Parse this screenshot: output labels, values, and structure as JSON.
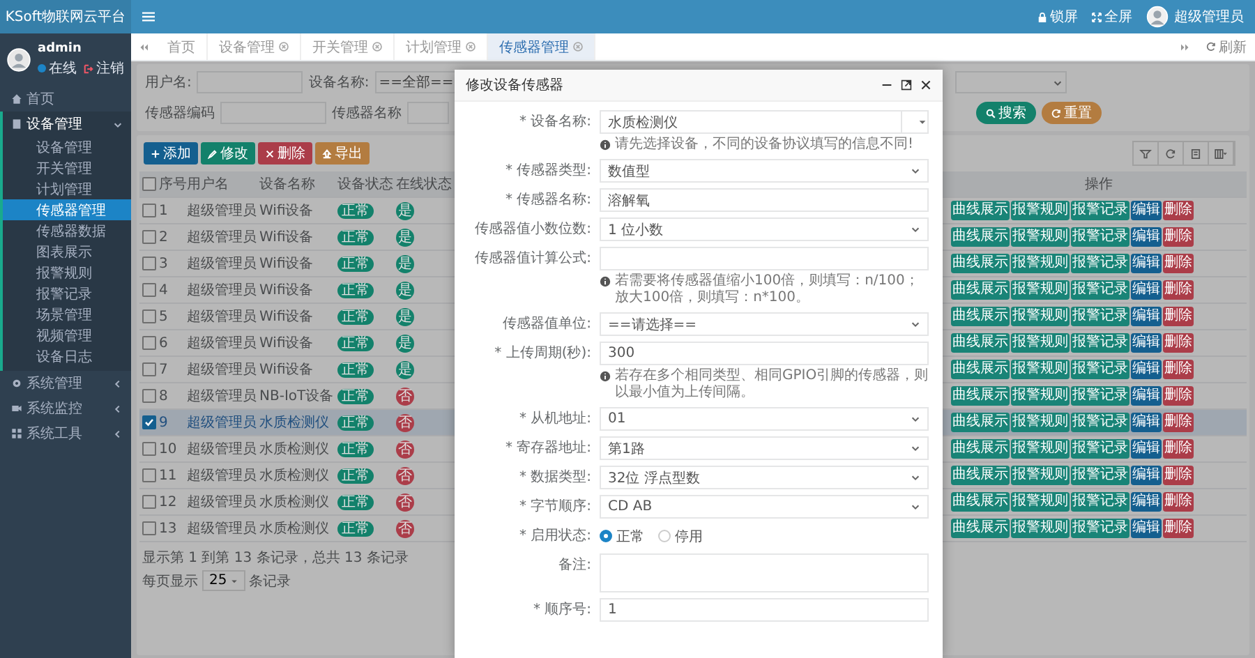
{
  "header": {
    "logo": "KSoft物联网云平台",
    "actions": [
      {
        "label": "锁屏"
      },
      {
        "label": "全屏"
      }
    ],
    "user": "超级管理员"
  },
  "sidebar": {
    "user": {
      "name": "admin",
      "status": "在线",
      "logout": "注销"
    },
    "menu": [
      {
        "kind": "link",
        "label": "首页"
      },
      {
        "kind": "group",
        "label": "设备管理",
        "expanded": true,
        "children": [
          {
            "label": "设备管理",
            "selected": false
          },
          {
            "label": "开关管理",
            "selected": false
          },
          {
            "label": "计划管理",
            "selected": false
          },
          {
            "label": "传感器管理",
            "selected": true
          },
          {
            "label": "传感器数据",
            "selected": false
          },
          {
            "label": "图表展示",
            "selected": false
          },
          {
            "label": "报警规则",
            "selected": false
          },
          {
            "label": "报警记录",
            "selected": false
          },
          {
            "label": "场景管理",
            "selected": false
          },
          {
            "label": "视频管理",
            "selected": false
          },
          {
            "label": "设备日志",
            "selected": false
          }
        ]
      },
      {
        "kind": "group",
        "label": "系统管理",
        "expanded": false
      },
      {
        "kind": "group",
        "label": "系统监控",
        "expanded": false
      },
      {
        "kind": "group",
        "label": "系统工具",
        "expanded": false
      }
    ]
  },
  "tabs": [
    {
      "label": "首页",
      "selected": false,
      "closable": false
    },
    {
      "label": "设备管理",
      "selected": false,
      "closable": true
    },
    {
      "label": "开关管理",
      "selected": false,
      "closable": true
    },
    {
      "label": "计划管理",
      "selected": false,
      "closable": true
    },
    {
      "label": "传感器管理",
      "selected": true,
      "closable": true
    }
  ],
  "refresh": "刷新",
  "search": {
    "rows": [
      {
        "fields": [
          {
            "label": "用户名:",
            "kind": "input"
          },
          {
            "label": "设备名称:",
            "kind": "select",
            "value": "==全部=="
          },
          {
            "kind": "select"
          }
        ]
      },
      {
        "fields": [
          {
            "label": "传感器编码",
            "kind": "input"
          },
          {
            "label": "传感器名称",
            "kind": "input"
          }
        ]
      }
    ],
    "buttons": [
      {
        "label": "搜索",
        "color": "#13816b"
      },
      {
        "label": "重置",
        "color": "#b37c40"
      }
    ]
  },
  "toolbar": [
    {
      "label": "添加",
      "color": "#145f8f"
    },
    {
      "label": "修改",
      "color": "#13816b"
    },
    {
      "label": "删除",
      "color": "#ab3d49"
    },
    {
      "label": "导出",
      "color": "#b37c40"
    }
  ],
  "table": {
    "all_checked": false,
    "columns": [
      "序号",
      "用户名",
      "设备名称",
      "设备状态",
      "在线状态",
      "操作"
    ],
    "rows": [
      {
        "checked": false,
        "selected": false,
        "no": "1",
        "user": "超级管理员",
        "device": "Wifi设备",
        "status": "正常",
        "online": {
          "text": "是",
          "ok": true
        },
        "actions": [
          "曲线展示",
          "报警规则",
          "报警记录",
          "编辑",
          "删除"
        ]
      },
      {
        "checked": false,
        "selected": false,
        "no": "2",
        "user": "超级管理员",
        "device": "Wifi设备",
        "status": "正常",
        "online": {
          "text": "是",
          "ok": true
        },
        "actions": [
          "曲线展示",
          "报警规则",
          "报警记录",
          "编辑",
          "删除"
        ]
      },
      {
        "checked": false,
        "selected": false,
        "no": "3",
        "user": "超级管理员",
        "device": "Wifi设备",
        "status": "正常",
        "online": {
          "text": "是",
          "ok": true
        },
        "actions": [
          "曲线展示",
          "报警规则",
          "报警记录",
          "编辑",
          "删除"
        ]
      },
      {
        "checked": false,
        "selected": false,
        "no": "4",
        "user": "超级管理员",
        "device": "Wifi设备",
        "status": "正常",
        "online": {
          "text": "是",
          "ok": true
        },
        "actions": [
          "曲线展示",
          "报警规则",
          "报警记录",
          "编辑",
          "删除"
        ]
      },
      {
        "checked": false,
        "selected": false,
        "no": "5",
        "user": "超级管理员",
        "device": "Wifi设备",
        "status": "正常",
        "online": {
          "text": "是",
          "ok": true
        },
        "actions": [
          "曲线展示",
          "报警规则",
          "报警记录",
          "编辑",
          "删除"
        ]
      },
      {
        "checked": false,
        "selected": false,
        "no": "6",
        "user": "超级管理员",
        "device": "Wifi设备",
        "status": "正常",
        "online": {
          "text": "是",
          "ok": true
        },
        "actions": [
          "曲线展示",
          "报警规则",
          "报警记录",
          "编辑",
          "删除"
        ]
      },
      {
        "checked": false,
        "selected": false,
        "no": "7",
        "user": "超级管理员",
        "device": "Wifi设备",
        "status": "正常",
        "online": {
          "text": "是",
          "ok": true
        },
        "actions": [
          "曲线展示",
          "报警规则",
          "报警记录",
          "编辑",
          "删除"
        ]
      },
      {
        "checked": false,
        "selected": false,
        "no": "8",
        "user": "超级管理员",
        "device": "NB-IoT设备",
        "status": "正常",
        "online": {
          "text": "否",
          "ok": false
        },
        "actions": [
          "曲线展示",
          "报警规则",
          "报警记录",
          "编辑",
          "删除"
        ]
      },
      {
        "checked": true,
        "selected": true,
        "no": "9",
        "user": "超级管理员",
        "device": "水质检测仪",
        "status": "正常",
        "online": {
          "text": "否",
          "ok": false
        },
        "actions": [
          "曲线展示",
          "报警规则",
          "报警记录",
          "编辑",
          "删除"
        ]
      },
      {
        "checked": false,
        "selected": false,
        "no": "10",
        "user": "超级管理员",
        "device": "水质检测仪",
        "status": "正常",
        "online": {
          "text": "否",
          "ok": false
        },
        "actions": [
          "曲线展示",
          "报警规则",
          "报警记录",
          "编辑",
          "删除"
        ]
      },
      {
        "checked": false,
        "selected": false,
        "no": "11",
        "user": "超级管理员",
        "device": "水质检测仪",
        "status": "正常",
        "online": {
          "text": "否",
          "ok": false
        },
        "actions": [
          "曲线展示",
          "报警规则",
          "报警记录",
          "编辑",
          "删除"
        ]
      },
      {
        "checked": false,
        "selected": false,
        "no": "12",
        "user": "超级管理员",
        "device": "水质检测仪",
        "status": "正常",
        "online": {
          "text": "否",
          "ok": false
        },
        "actions": [
          "曲线展示",
          "报警规则",
          "报警记录",
          "编辑",
          "删除"
        ]
      },
      {
        "checked": false,
        "selected": false,
        "no": "13",
        "user": "超级管理员",
        "device": "水质检测仪",
        "status": "正常",
        "online": {
          "text": "否",
          "ok": false
        },
        "actions": [
          "曲线展示",
          "报警规则",
          "报警记录",
          "编辑",
          "删除"
        ]
      }
    ]
  },
  "pagination": {
    "info": "显示第 1 到第 13 条记录，总共 13 条记录",
    "per_page_label": "每页显示",
    "page_size": "25",
    "per_page_suffix": "条记录"
  },
  "modal": {
    "title": "修改设备传感器",
    "fields": [
      {
        "label": "* 设备名称:",
        "kind": "combo",
        "value": "水质检测仪",
        "help": "请先选择设备，不同的设备协议填写的信息不同!"
      },
      {
        "label": "* 传感器类型:",
        "kind": "select",
        "value": "数值型"
      },
      {
        "label": "* 传感器名称:",
        "kind": "input",
        "value": "溶解氧"
      },
      {
        "label": "传感器值小数位数:",
        "kind": "select",
        "value": "1 位小数"
      },
      {
        "label": "传感器值计算公式:",
        "kind": "input",
        "help": "若需要将传感器值缩小100倍，则填写：n/100；放大100倍，则填写：n*100。"
      },
      {
        "label": "传感器值单位:",
        "kind": "select",
        "value": "==请选择=="
      },
      {
        "label": "* 上传周期(秒):",
        "kind": "input",
        "value": "300",
        "help": "若存在多个相同类型、相同GPIO引脚的传感器，则以最小值为上传间隔。"
      },
      {
        "label": "* 从机地址:",
        "kind": "select",
        "value": "01"
      },
      {
        "label": "* 寄存器地址:",
        "kind": "select",
        "value": "第1路"
      },
      {
        "label": "* 数据类型:",
        "kind": "select",
        "value": "32位 浮点型数"
      },
      {
        "label": "* 字节顺序:",
        "kind": "select",
        "value": "CD AB"
      },
      {
        "label": "* 启用状态:",
        "kind": "radio",
        "options": [
          {
            "label": "正常",
            "selected": true
          },
          {
            "label": "停用",
            "selected": false
          }
        ]
      },
      {
        "label": "备注:",
        "kind": "textarea"
      },
      {
        "label": "* 顺序号:",
        "kind": "input",
        "value": "1"
      }
    ]
  }
}
